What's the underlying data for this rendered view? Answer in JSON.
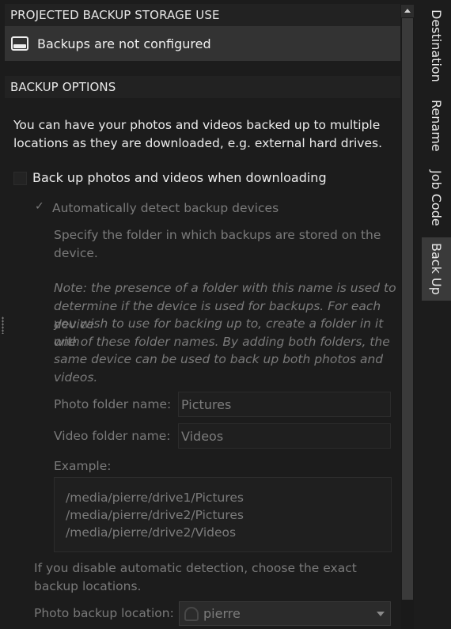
{
  "storage": {
    "header": "PROJECTED BACKUP STORAGE USE",
    "status_icon": "drive-icon",
    "status_text": "Backups are not configured"
  },
  "options": {
    "header": "BACKUP OPTIONS",
    "intro_line1": "You can have your photos and videos backed up to multiple",
    "intro_line2": "locations as they are downloaded, e.g. external hard drives.",
    "backup_checkbox_label": "Back up photos and videos when downloading",
    "backup_checkbox_checked": false,
    "auto_detect_checkmark": "✓",
    "auto_detect_label": "Automatically detect backup devices",
    "auto_detect_checked": true,
    "folder_desc_line1": "Specify the folder in which backups are stored on the",
    "folder_desc_line2": "device.",
    "note_lines": [
      "Note: the presence of a folder with this name is used to",
      "determine if the device is used for backups. For each device",
      "you wish to use for backing up to, create a folder in it with",
      "one of these folder names. By adding both folders, the",
      "same device can be used to back up both photos and",
      "videos."
    ],
    "photo_folder_label": "Photo folder name:",
    "photo_folder_value": "Pictures",
    "video_folder_label": "Video folder name:",
    "video_folder_value": "Videos",
    "example_label": "Example:",
    "example_lines": [
      "/media/pierre/drive1/Pictures",
      "/media/pierre/drive2/Pictures",
      "/media/pierre/drive2/Videos"
    ],
    "manual_line1": "If you disable automatic detection, choose the exact",
    "manual_line2": "backup locations.",
    "photo_location_label": "Photo backup location:",
    "photo_location_value": "pierre"
  },
  "tabs": [
    {
      "label": "Destination",
      "active": false
    },
    {
      "label": "Rename",
      "active": false
    },
    {
      "label": "Job Code",
      "active": false
    },
    {
      "label": "Back Up",
      "active": true
    }
  ],
  "colors": {
    "background": "#1c1c1c",
    "header_bg": "#222222",
    "status_row_bg": "#333333",
    "active_tab_bg": "#3a3a3a",
    "disabled_text": "#7a7a7a"
  }
}
